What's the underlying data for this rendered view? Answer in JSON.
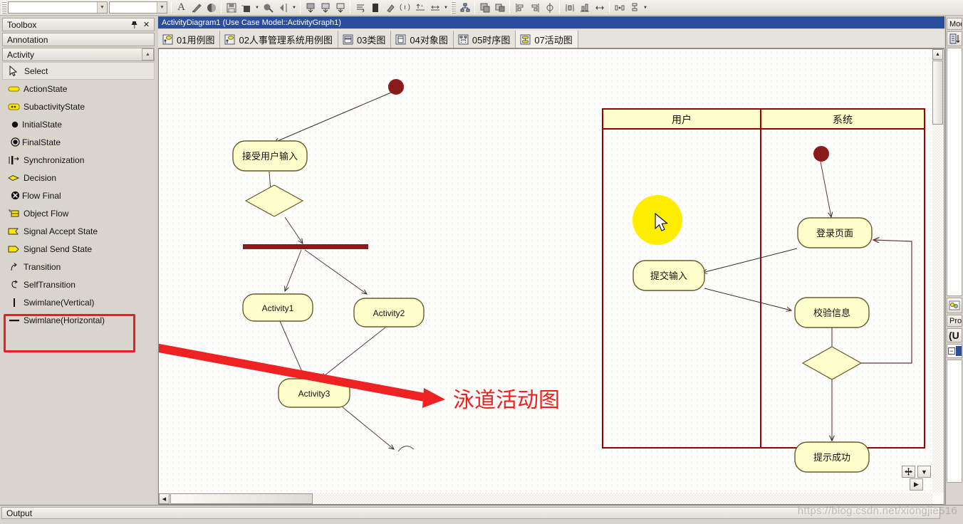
{
  "toolbar": {
    "combo1_value": "",
    "combo2_value": "",
    "buttons": [
      {
        "name": "text-tool-icon",
        "glyph": "A"
      },
      {
        "name": "line-style-icon",
        "glyph": "✒"
      },
      {
        "name": "fill-color-icon",
        "glyph": "◕"
      },
      {
        "name": "save-icon",
        "glyph": "⎙"
      },
      {
        "name": "fill-bucket-icon",
        "glyph": "■"
      },
      {
        "name": "font-color-icon",
        "glyph": "⚘"
      },
      {
        "name": "mirror-icon",
        "glyph": "◁"
      },
      {
        "name": "bring-front-icon",
        "glyph": "⬇"
      },
      {
        "name": "send-back-icon",
        "glyph": "⬆"
      },
      {
        "name": "layer-icon",
        "glyph": "⬍"
      },
      {
        "name": "list-icon",
        "glyph": "≡"
      },
      {
        "name": "page-icon",
        "glyph": "▮"
      },
      {
        "name": "stamp-icon",
        "glyph": "⌘"
      },
      {
        "name": "bracket-icon",
        "glyph": "()"
      },
      {
        "name": "align-top-icon",
        "glyph": "⤒"
      },
      {
        "name": "align-mid-icon",
        "glyph": "↔"
      },
      {
        "name": "hierarchy-icon",
        "glyph": "⚯"
      },
      {
        "name": "grid-icon",
        "glyph": "▦"
      },
      {
        "name": "group-icon",
        "glyph": "❐"
      },
      {
        "name": "align-left-icon",
        "glyph": "⊏"
      },
      {
        "name": "align-right-icon",
        "glyph": "⊐"
      },
      {
        "name": "align-center-icon",
        "glyph": "⨁"
      },
      {
        "name": "distribute-h-icon",
        "glyph": "⫼"
      },
      {
        "name": "distribute-v-icon",
        "glyph": "⫝"
      },
      {
        "name": "resize-icon",
        "glyph": "⋈"
      },
      {
        "name": "spacing-icon",
        "glyph": "⧉"
      },
      {
        "name": "node-icon",
        "glyph": "⚭"
      }
    ]
  },
  "toolbox": {
    "title": "Toolbox",
    "pin_icon": "pin-icon",
    "close_icon": "close-icon",
    "annotation_group": "Annotation",
    "activity_group": "Activity",
    "items": [
      {
        "label": "Select",
        "icon": "cursor-icon",
        "selected": true
      },
      {
        "label": "ActionState",
        "icon": "action-state-icon",
        "selected": false
      },
      {
        "label": "SubactivityState",
        "icon": "subactivity-state-icon",
        "selected": false
      },
      {
        "label": "InitialState",
        "icon": "initial-state-icon",
        "selected": false
      },
      {
        "label": "FinalState",
        "icon": "final-state-icon",
        "selected": false
      },
      {
        "label": "Synchronization",
        "icon": "synchronization-icon",
        "selected": false
      },
      {
        "label": "Decision",
        "icon": "decision-icon",
        "selected": false
      },
      {
        "label": "Flow Final",
        "icon": "flow-final-icon",
        "selected": false
      },
      {
        "label": "Object Flow",
        "icon": "object-flow-icon",
        "selected": false
      },
      {
        "label": "Signal Accept State",
        "icon": "signal-accept-icon",
        "selected": false
      },
      {
        "label": "Signal Send State",
        "icon": "signal-send-icon",
        "selected": false
      },
      {
        "label": "Transition",
        "icon": "transition-icon",
        "selected": false
      },
      {
        "label": "SelfTransition",
        "icon": "self-transition-icon",
        "selected": false
      },
      {
        "label": "Swimlane(Vertical)",
        "icon": "swimlane-vertical-icon",
        "selected": false
      },
      {
        "label": "Swimlane(Horizontal)",
        "icon": "swimlane-horizontal-icon",
        "selected": false
      }
    ],
    "highlight_color": "#ed1c24"
  },
  "document": {
    "title": "ActivityDiagram1 (Use Case Model::ActivityGraph1)"
  },
  "tabs": [
    {
      "label": "01用例图",
      "icon": "usecase-diagram-icon",
      "active": false
    },
    {
      "label": "02人事管理系统用例图",
      "icon": "usecase-diagram-icon",
      "active": false
    },
    {
      "label": "03类图",
      "icon": "class-diagram-icon",
      "active": false
    },
    {
      "label": "04对象图",
      "icon": "object-diagram-icon",
      "active": false
    },
    {
      "label": "05时序图",
      "icon": "sequence-diagram-icon",
      "active": false
    },
    {
      "label": "07活动图",
      "icon": "activity-diagram-icon",
      "active": true
    }
  ],
  "canvas": {
    "annotation_text": "泳道活动图",
    "annotation_color": "#f21f1f",
    "left_diagram": {
      "initial_state": {
        "label": ""
      },
      "nodes": [
        {
          "id": "n1",
          "label": "接受用户输入",
          "shape": "action-state"
        },
        {
          "id": "n2",
          "label": "",
          "shape": "decision"
        },
        {
          "id": "n3",
          "label": "",
          "shape": "synchronization-bar"
        },
        {
          "id": "n4",
          "label": "Activity1",
          "shape": "action-state"
        },
        {
          "id": "n5",
          "label": "Activity2",
          "shape": "action-state"
        },
        {
          "id": "n6",
          "label": "Activity3",
          "shape": "action-state"
        }
      ]
    },
    "swimlane_diagram": {
      "lanes": [
        {
          "header": "用户"
        },
        {
          "header": "系统"
        }
      ],
      "nodes": [
        {
          "id": "s1",
          "label": "提交输入",
          "lane": 0,
          "shape": "action-state"
        },
        {
          "id": "s2",
          "label": "登录页面",
          "lane": 1,
          "shape": "action-state"
        },
        {
          "id": "s3",
          "label": "校验信息",
          "lane": 1,
          "shape": "action-state"
        },
        {
          "id": "s4",
          "label": "",
          "lane": 1,
          "shape": "decision"
        },
        {
          "id": "s5",
          "label": "提示成功",
          "lane": 1,
          "shape": "action-state"
        }
      ],
      "header_fill": "#ffffcc",
      "border_color": "#990000",
      "node_fill": "#ffffcc"
    },
    "cursor_highlight": {
      "color": "#ffee00",
      "shape": "circle"
    },
    "zoom_buttons": [
      "pan-tool-icon",
      "zoom-dropdown-icon",
      "next-page-icon"
    ]
  },
  "right_dock": {
    "model_label": "Mod",
    "sort-icon": "sort-icon",
    "properties_label": "Prop",
    "tree_root_label": "(U",
    "expand_icon": "collapse-box-icon"
  },
  "output": {
    "title": "Output"
  },
  "watermark": {
    "text": "https://blog.csdn.net/xiongjie516"
  }
}
